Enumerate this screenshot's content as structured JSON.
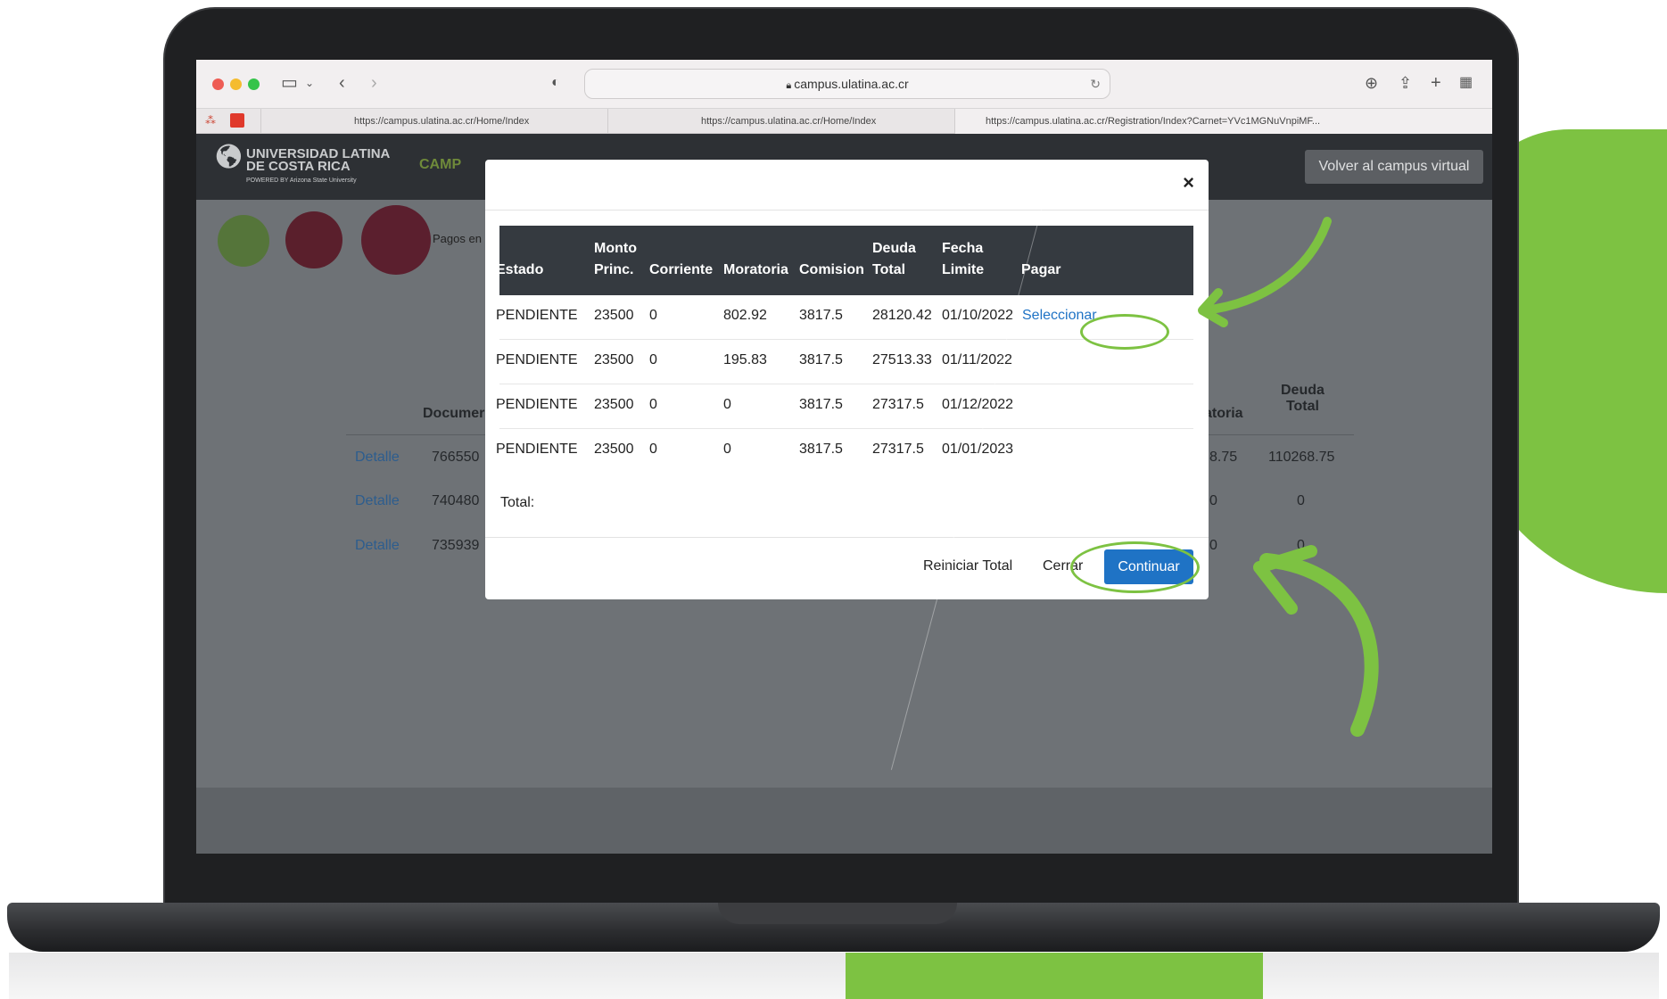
{
  "browser": {
    "url": "campus.ulatina.ac.cr",
    "tabs": [
      "https://campus.ulatina.ac.cr/Home/Index",
      "https://campus.ulatina.ac.cr/Home/Index",
      "https://campus.ulatina.ac.cr/Registration/Index?Carnet=YVc1MGNuVnpiMF..."
    ]
  },
  "header": {
    "logo_line1": "UNIVERSIDAD LATINA",
    "logo_line2": "DE COSTA RICA",
    "logo_sub": "POWERED BY Arizona State University",
    "campus_link": "CAMP",
    "volver_button": "Volver al campus virtual"
  },
  "page": {
    "pagos_label": "Pagos en",
    "col_documento": "Documer",
    "col_moratoria": "atoria",
    "col_deuda_line1": "Deuda",
    "col_deuda_line2": "Total",
    "rows": [
      {
        "detalle": "Detalle",
        "doc": "766550",
        "mora": "8.75",
        "deuda": "110268.75"
      },
      {
        "detalle": "Detalle",
        "doc": "740480",
        "mora": "0",
        "deuda": "0"
      },
      {
        "detalle": "Detalle",
        "doc": "735939",
        "mora": "0",
        "deuda": "0"
      }
    ]
  },
  "modal": {
    "close": "×",
    "headers": {
      "estado": "Estado",
      "monto1": "Monto",
      "monto2": "Princ.",
      "corriente": "Corriente",
      "moratoria": "Moratoria",
      "comision": "Comision",
      "deuda1": "Deuda",
      "deuda2": "Total",
      "fecha1": "Fecha",
      "fecha2": "Limite",
      "pagar": "Pagar"
    },
    "rows": [
      {
        "estado": "PENDIENTE",
        "monto": "23500",
        "corriente": "0",
        "moratoria": "802.92",
        "comision": "3817.5",
        "deuda": "28120.42",
        "fecha": "01/10/2022",
        "pagar": "Seleccionar"
      },
      {
        "estado": "PENDIENTE",
        "monto": "23500",
        "corriente": "0",
        "moratoria": "195.83",
        "comision": "3817.5",
        "deuda": "27513.33",
        "fecha": "01/11/2022",
        "pagar": ""
      },
      {
        "estado": "PENDIENTE",
        "monto": "23500",
        "corriente": "0",
        "moratoria": "0",
        "comision": "3817.5",
        "deuda": "27317.5",
        "fecha": "01/12/2022",
        "pagar": ""
      },
      {
        "estado": "PENDIENTE",
        "monto": "23500",
        "corriente": "0",
        "moratoria": "0",
        "comision": "3817.5",
        "deuda": "27317.5",
        "fecha": "01/01/2023",
        "pagar": ""
      }
    ],
    "total_label": "Total:",
    "reiniciar_button": "Reiniciar Total",
    "cerrar_button": "Cerrar",
    "continuar_button": "Continuar"
  },
  "colors": {
    "accent_green": "#7dc242",
    "primary_blue": "#1f73c5",
    "table_header": "#353a40"
  }
}
